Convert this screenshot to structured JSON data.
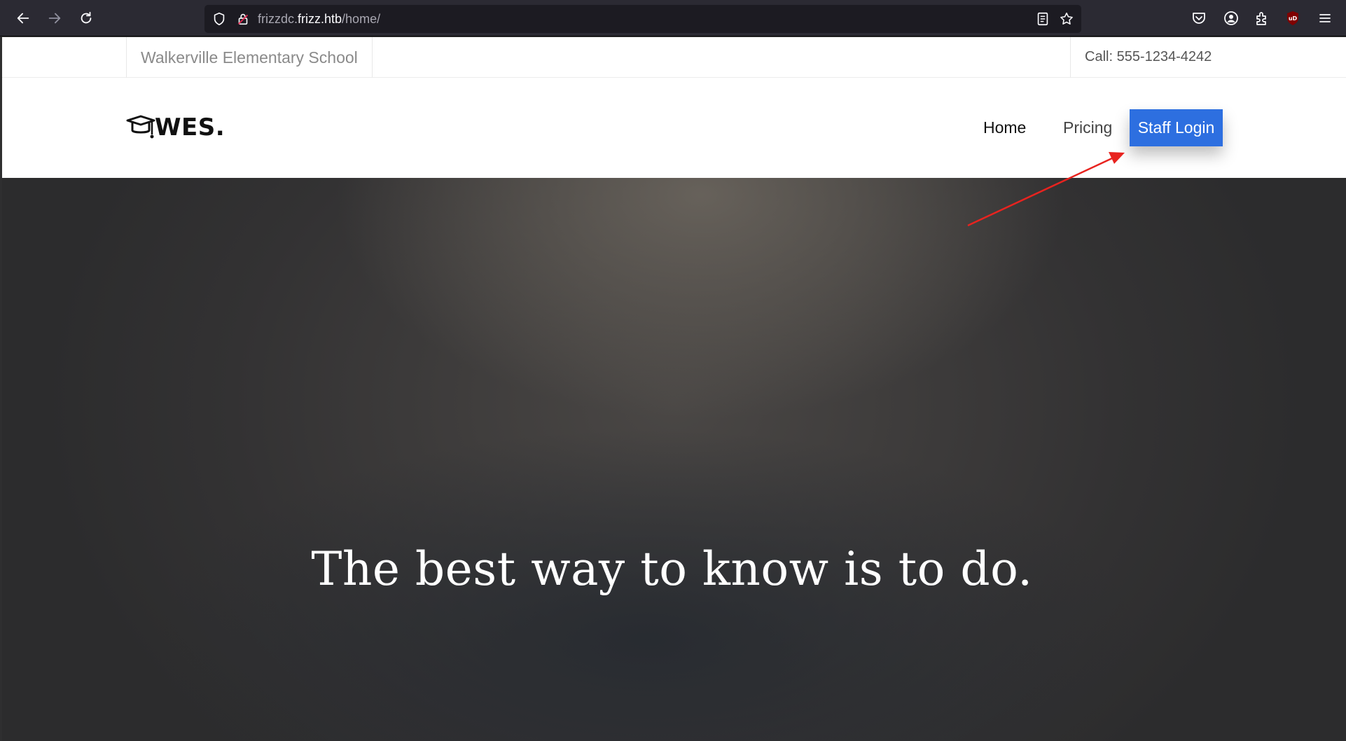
{
  "browser": {
    "url_prefix": "frizzdc.",
    "url_domain": "frizz.htb",
    "url_path": "/home/",
    "icons": [
      "back-arrow-icon",
      "forward-arrow-icon",
      "reload-icon",
      "shield-icon",
      "lock-icon",
      "reader-view-icon",
      "bookmark-star-icon",
      "pocket-icon",
      "account-icon",
      "extensions-icon",
      "ublock-icon",
      "menu-icon"
    ]
  },
  "topbar": {
    "school_name": "Walkerville Elementary School",
    "call": "Call: 555-1234-4242"
  },
  "header": {
    "logo_text": "WES.",
    "nav": {
      "home": "Home",
      "pricing": "Pricing",
      "staff_login": "Staff Login"
    }
  },
  "hero": {
    "title": "The best way to know is to do."
  },
  "colors": {
    "login_button": "#2d6fe0",
    "annotation_arrow": "#e8231f",
    "browser_chrome": "#2b2a33"
  }
}
